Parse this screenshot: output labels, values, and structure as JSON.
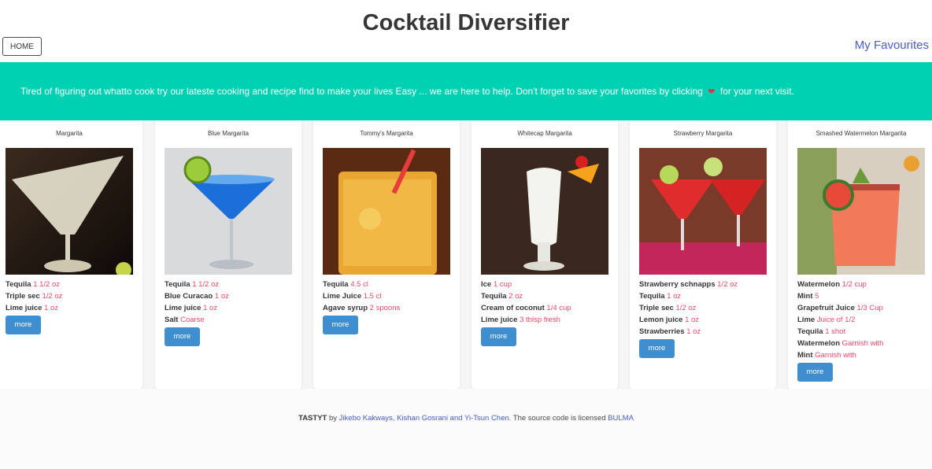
{
  "header": {
    "title": "Cocktail Diversifier",
    "home_label": "HOME",
    "favourites_label": "My Favourites"
  },
  "hero": {
    "text_before": "Tired of figuring out whatto cook try our lateste cooking and recipe find to make your lives Easy ... we are here to help. Don't forget to save your favorites by clicking",
    "heart_icon": "heart-icon",
    "text_after": "for your next visit."
  },
  "cards": [
    {
      "name": "Margarita",
      "image": "margarita-photo",
      "ingredients": [
        {
          "name": "Tequila",
          "measure": "1 1/2 oz"
        },
        {
          "name": "Triple sec",
          "measure": "1/2 oz"
        },
        {
          "name": "Lime juice",
          "measure": "1 oz"
        }
      ],
      "more_label": "more"
    },
    {
      "name": "Blue Margarita",
      "image": "blue-margarita-photo",
      "ingredients": [
        {
          "name": "Tequila",
          "measure": "1 1/2 oz"
        },
        {
          "name": "Blue Curacao",
          "measure": "1 oz"
        },
        {
          "name": "Lime juice",
          "measure": "1 oz"
        },
        {
          "name": "Salt",
          "measure": "Coarse"
        }
      ],
      "more_label": "more"
    },
    {
      "name": "Tommy's Margarita",
      "image": "tommys-margarita-photo",
      "ingredients": [
        {
          "name": "Tequila",
          "measure": "4.5 cl"
        },
        {
          "name": "Lime Juice",
          "measure": "1.5 cl"
        },
        {
          "name": "Agave syrup",
          "measure": "2 spoons"
        }
      ],
      "more_label": "more"
    },
    {
      "name": "Whitecap Margarita",
      "image": "whitecap-margarita-photo",
      "ingredients": [
        {
          "name": "Ice",
          "measure": "1 cup"
        },
        {
          "name": "Tequila",
          "measure": "2 oz"
        },
        {
          "name": "Cream of coconut",
          "measure": "1/4 cup"
        },
        {
          "name": "Lime juice",
          "measure": "3 tblsp fresh"
        }
      ],
      "more_label": "more"
    },
    {
      "name": "Strawberry Margarita",
      "image": "strawberry-margarita-photo",
      "ingredients": [
        {
          "name": "Strawberry schnapps",
          "measure": "1/2 oz"
        },
        {
          "name": "Tequila",
          "measure": "1 oz"
        },
        {
          "name": "Triple sec",
          "measure": "1/2 oz"
        },
        {
          "name": "Lemon juice",
          "measure": "1 oz"
        },
        {
          "name": "Strawberries",
          "measure": "1 oz"
        }
      ],
      "more_label": "more"
    },
    {
      "name": "Smashed Watermelon Margarita",
      "image": "smashed-watermelon-margarita-photo",
      "ingredients": [
        {
          "name": "Watermelon",
          "measure": "1/2 cup"
        },
        {
          "name": "Mint",
          "measure": "5"
        },
        {
          "name": "Grapefruit Juice",
          "measure": "1/3 Cup"
        },
        {
          "name": "Lime",
          "measure": "Juice of 1/2"
        },
        {
          "name": "Tequila",
          "measure": "1 shot"
        },
        {
          "name": "Watermelon",
          "measure": "Garnish with"
        },
        {
          "name": "Mint",
          "measure": "Garnish with"
        }
      ],
      "more_label": "more"
    }
  ],
  "footer": {
    "brand": "TASTYT",
    "by": "by",
    "authors": "Jikebo Kakways, Kishan Gosrani and Yi-Tsun Chen",
    "license_text": ". The source code is licensed",
    "license_link": "BULMA"
  },
  "colors": {
    "hero_bg": "#00d1b2",
    "link": "#485fc7",
    "measure": "#f14668",
    "button": "#3e8ed0",
    "heart": "#e0314b"
  }
}
